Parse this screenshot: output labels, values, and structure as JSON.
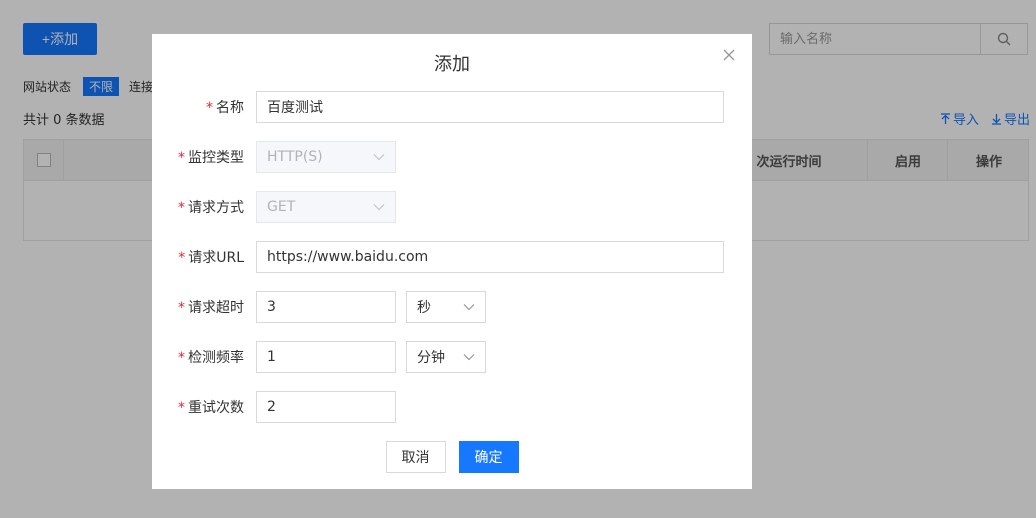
{
  "toolbar": {
    "add_label": "+添加"
  },
  "search": {
    "placeholder": "输入名称"
  },
  "filter": {
    "label": "网站状态",
    "selected": "不限",
    "next_label": "连接"
  },
  "summary": {
    "total_text": "共计 0 条数据"
  },
  "io": {
    "import_label": "导入",
    "export_label": "导出"
  },
  "table": {
    "headers": {
      "last_run": "次运行时间",
      "enabled": "启用",
      "actions": "操作"
    }
  },
  "dialog": {
    "title": "添加",
    "required_mark": "*",
    "fields": {
      "name": {
        "label": "名称",
        "value": "百度测试"
      },
      "monitor_type": {
        "label": "监控类型",
        "value": "HTTP(S)"
      },
      "method": {
        "label": "请求方式",
        "value": "GET"
      },
      "url": {
        "label": "请求URL",
        "value": "https://www.baidu.com"
      },
      "timeout": {
        "label": "请求超时",
        "value": "3",
        "unit": "秒"
      },
      "frequency": {
        "label": "检测频率",
        "value": "1",
        "unit": "分钟"
      },
      "retries": {
        "label": "重试次数",
        "value": "2"
      }
    },
    "cancel_label": "取消",
    "confirm_label": "确定"
  },
  "colors": {
    "primary": "#1677ff",
    "required": "#f5222d",
    "overlay": "rgba(0,0,0,0.3)"
  }
}
